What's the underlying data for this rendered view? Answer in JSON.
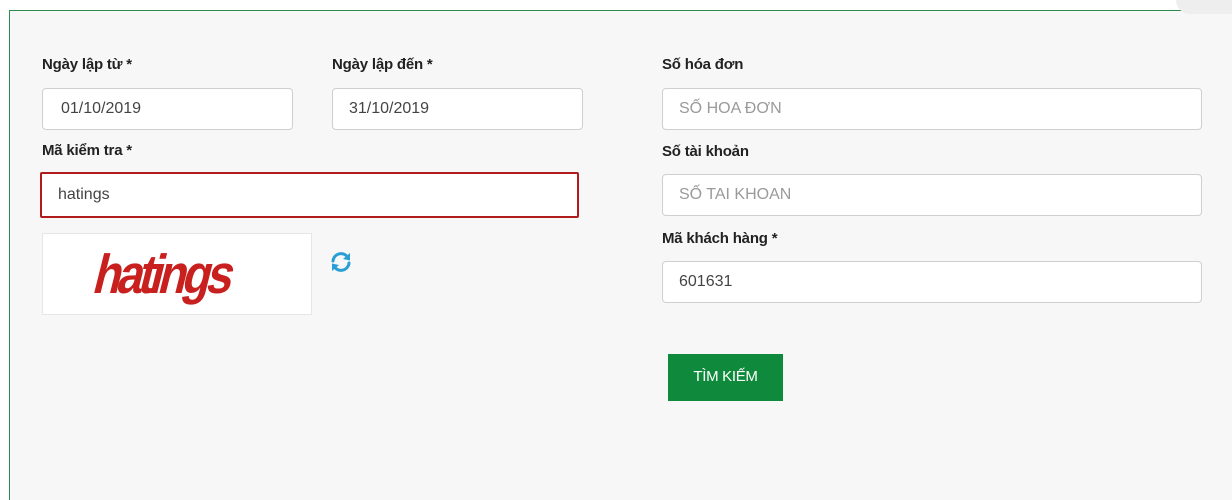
{
  "form": {
    "date_from": {
      "label": "Ngày lập từ *",
      "value": "01/10/2019"
    },
    "date_to": {
      "label": "Ngày lập đến *",
      "value": "31/10/2019"
    },
    "captcha_code": {
      "label": "Mã kiểm tra *",
      "value": "hatings"
    },
    "captcha_image_text": "hatings",
    "invoice_number": {
      "label": "Số hóa đơn",
      "placeholder": "SỐ HOA ĐƠN"
    },
    "account_number": {
      "label": "Số tài khoản",
      "placeholder": "SỐ TAI KHOAN"
    },
    "customer_code": {
      "label": "Mã khách hàng *",
      "value": "601631"
    },
    "search_button": "TÌM KIẾM"
  },
  "colors": {
    "accent_green": "#0f8a3c",
    "error_red": "#b11b1b",
    "captcha_red": "#c8201e",
    "refresh_blue": "#2a9fd6"
  },
  "icons": {
    "refresh": "refresh-icon"
  }
}
